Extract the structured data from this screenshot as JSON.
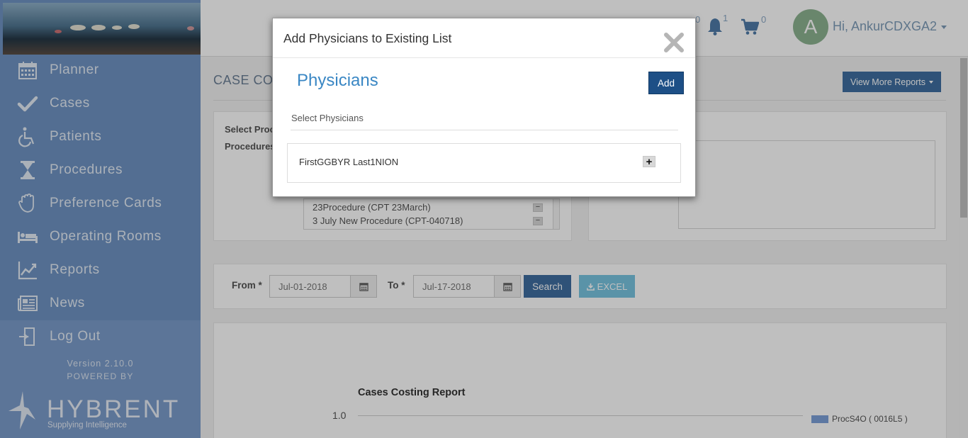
{
  "sidebar": {
    "items": [
      {
        "label": "Planner",
        "icon": "calendar-icon"
      },
      {
        "label": "Cases",
        "icon": "checkmark-icon"
      },
      {
        "label": "Patients",
        "icon": "wheelchair-icon"
      },
      {
        "label": "Procedures",
        "icon": "hourglass-icon"
      },
      {
        "label": "Preference Cards",
        "icon": "glove-icon"
      },
      {
        "label": "Operating Rooms",
        "icon": "bed-icon"
      },
      {
        "label": "Reports",
        "icon": "line-chart-icon"
      },
      {
        "label": "News",
        "icon": "newspaper-icon"
      },
      {
        "label": "Log Out",
        "icon": "logout-icon"
      }
    ],
    "version": "Version 2.10.0",
    "powered_by": "POWERED BY",
    "brand": "HYBRENT",
    "tagline": "Supplying Intelligence"
  },
  "header": {
    "avatar_letter": "A",
    "greeting": "Hi, AnkurCDXGA2",
    "notifications_count": "1",
    "cart_count": "0",
    "hidden_count": "0"
  },
  "main": {
    "page_title": "CASE COS",
    "view_more_reports": "View More Reports",
    "select_label": "Select Proc",
    "procedures_label": "Procedures",
    "procedure_rows": [
      "23Procedure (CPT 23March)",
      "3 July New Procedure (CPT-040718)"
    ],
    "from_label": "From *",
    "from_value": "Jul-01-2018",
    "to_label": "To *",
    "to_value": "Jul-17-2018",
    "search_label": "Search",
    "excel_label": "EXCEL"
  },
  "chart_data": {
    "type": "bar",
    "title": "Cases Costing Report",
    "y_ticks": [
      "1.0"
    ],
    "series": [
      {
        "name": "ProcS4O ( 0016L5 )",
        "values": []
      }
    ],
    "legend_position": "right"
  },
  "modal": {
    "title": "Add Physicians to Existing List",
    "section_title": "Physicians",
    "add_label": "Add",
    "select_label": "Select Physicians",
    "physicians": [
      "FirstGGBYR Last1NION"
    ]
  },
  "colors": {
    "sidebar": "#6f93c3",
    "primary_button": "#3f6ea0",
    "modal_add": "#1d4f86",
    "section_title": "#3a87c4",
    "excel_button": "#79c4e0"
  }
}
